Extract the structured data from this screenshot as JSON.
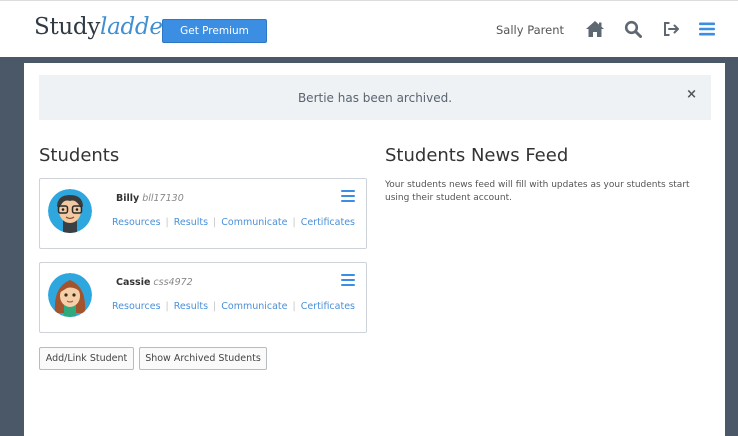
{
  "header": {
    "logo_study": "Study",
    "logo_ladder": "ladder",
    "premium_label": "Get Premium",
    "user_name": "Sally Parent"
  },
  "alert": {
    "message": "Bertie has been archived.",
    "close": "×"
  },
  "students": {
    "title": "Students",
    "items": [
      {
        "name": "Billy",
        "id": "bll17130",
        "links": [
          "Resources",
          "Results",
          "Communicate",
          "Certificates"
        ]
      },
      {
        "name": "Cassie",
        "id": "css4972",
        "links": [
          "Resources",
          "Results",
          "Communicate",
          "Certificates"
        ]
      }
    ],
    "add_label": "Add/Link Student",
    "archived_label": "Show Archived Students"
  },
  "news": {
    "title": "Students News Feed",
    "text": "Your students news feed will fill with updates as your students start using their student account."
  },
  "colors": {
    "accent": "#3c8ee2",
    "frame": "#4b5868",
    "alert_bg": "#eef2f5"
  },
  "icons": [
    "home-icon",
    "search-icon",
    "logout-icon",
    "menu-icon"
  ]
}
